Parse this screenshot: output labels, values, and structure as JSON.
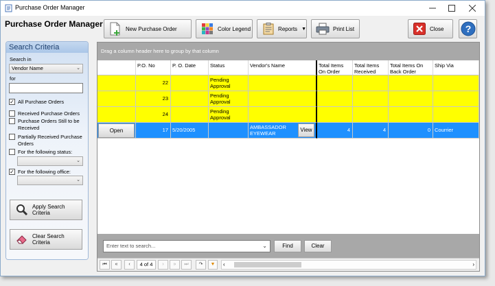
{
  "window": {
    "title": "Purchase Order Manager"
  },
  "header": {
    "title": "Purchase Order Manager"
  },
  "toolbar": {
    "new_po": "New Purchase Order",
    "color_legend": "Color Legend",
    "reports": "Reports",
    "print_list": "Print List",
    "close": "Close"
  },
  "search_criteria": {
    "title": "Search Criteria",
    "search_in_label": "Search in",
    "search_in_value": "Vendor Name",
    "for_label": "for",
    "for_value": "",
    "options": [
      {
        "label": "All Purchase Orders",
        "checked": true
      },
      {
        "label": "Received Purchase Orders",
        "checked": false
      },
      {
        "label": "Purchase Orders Still to be Received",
        "checked": false
      },
      {
        "label": "Partially Received Purchase Orders",
        "checked": false
      },
      {
        "label": "For the following status:",
        "checked": false
      },
      {
        "label": "For the following office:",
        "checked": true
      }
    ],
    "status_value": "",
    "office_value": "",
    "apply_label": "Apply Search Criteria",
    "clear_label": "Clear Search Criteria"
  },
  "grid": {
    "group_hint": "Drag a column header here to group by that column",
    "columns": [
      "",
      "P.O. No",
      "P. O. Date",
      "Status",
      "Vendor's Name",
      "Total Items On Order",
      "Total Items Received",
      "Total Items On Back Order",
      "Ship Via"
    ],
    "rows": [
      {
        "action": "",
        "po_no": "22",
        "po_date": "",
        "status": "Pending Approval",
        "vendor": "",
        "on_order": "",
        "received": "",
        "back_order": "",
        "ship_via": "",
        "color": "#ffff00"
      },
      {
        "action": "",
        "po_no": "23",
        "po_date": "",
        "status": "Pending Approval",
        "vendor": "",
        "on_order": "",
        "received": "",
        "back_order": "",
        "ship_via": "",
        "color": "#ffff00"
      },
      {
        "action": "",
        "po_no": "24",
        "po_date": "",
        "status": "Pending Approval",
        "vendor": "",
        "on_order": "",
        "received": "",
        "back_order": "",
        "ship_via": "",
        "color": "#ffff00"
      },
      {
        "action": "Open",
        "po_no": "17",
        "po_date": "5/20/2005",
        "status": "",
        "vendor": "AMBASSADOR EYEWEAR",
        "vendor_button": "View",
        "on_order": "4",
        "received": "4",
        "back_order": "0",
        "ship_via": "Courrier",
        "color": "#1e90ff"
      }
    ]
  },
  "search_bar": {
    "placeholder": "Enter text to search...",
    "find_label": "Find",
    "clear_label": "Clear"
  },
  "navigator": {
    "position": "4 of 4"
  }
}
